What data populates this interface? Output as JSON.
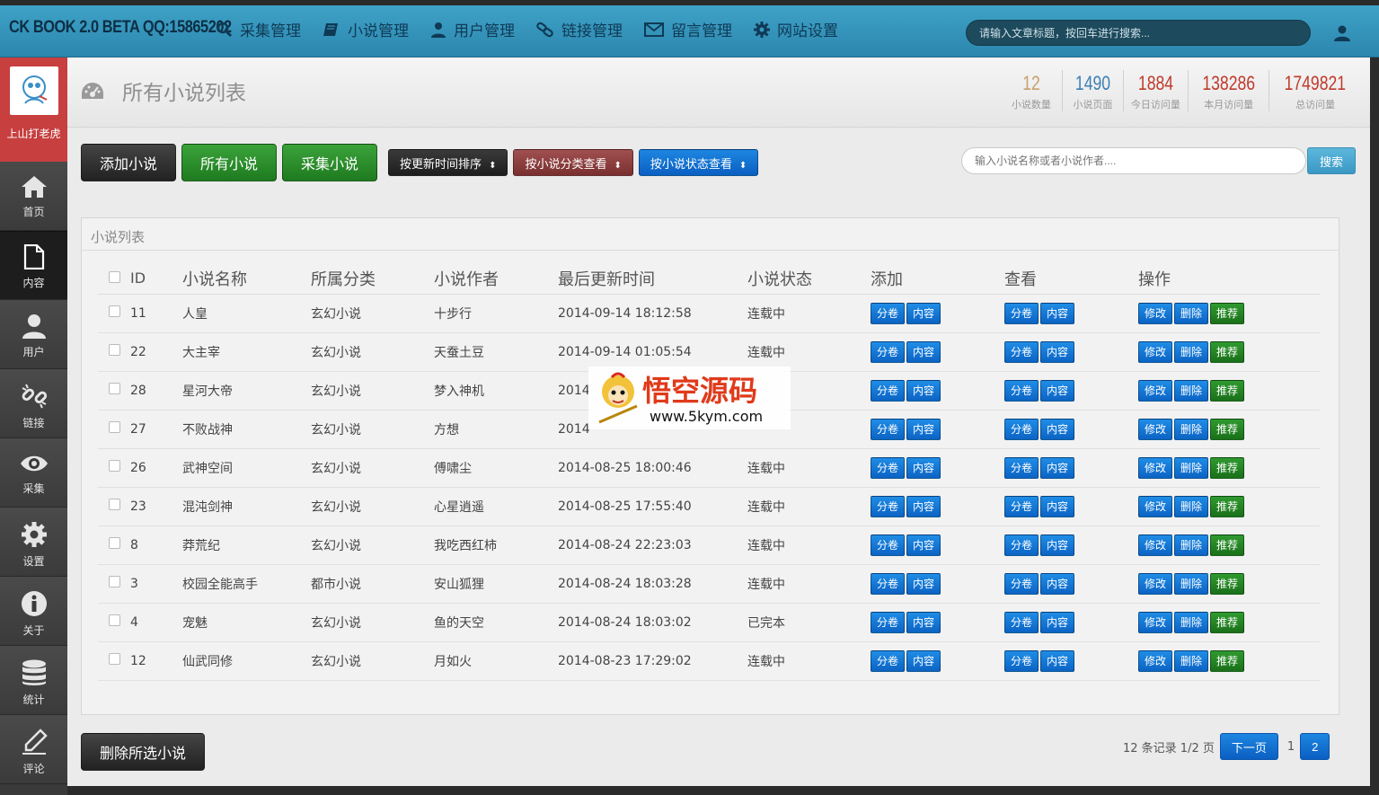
{
  "brand": "CK BOOK 2.0 BETA QQ:15865202",
  "nav": [
    {
      "label": "采集管理",
      "icon": "search-icon"
    },
    {
      "label": "小说管理",
      "icon": "book-icon"
    },
    {
      "label": "用户管理",
      "icon": "user-icon"
    },
    {
      "label": "链接管理",
      "icon": "link-icon"
    },
    {
      "label": "留言管理",
      "icon": "mail-icon"
    },
    {
      "label": "网站设置",
      "icon": "gear-icon"
    }
  ],
  "top_search": {
    "placeholder": "请输入文章标题，按回车进行搜索..."
  },
  "sidebar": {
    "profile_name": "上山打老虎",
    "items": [
      {
        "label": "首页",
        "icon": "home-icon"
      },
      {
        "label": "内容",
        "icon": "document-icon",
        "active": true
      },
      {
        "label": "用户",
        "icon": "user-icon"
      },
      {
        "label": "链接",
        "icon": "broken-link-icon"
      },
      {
        "label": "采集",
        "icon": "eye-icon"
      },
      {
        "label": "设置",
        "icon": "gear-icon"
      },
      {
        "label": "关于",
        "icon": "info-icon"
      },
      {
        "label": "统计",
        "icon": "database-icon"
      },
      {
        "label": "评论",
        "icon": "pencil-icon"
      }
    ]
  },
  "page": {
    "title": "所有小说列表"
  },
  "stats": [
    {
      "value": "12",
      "label": "小说数量",
      "color": "#c8a06a"
    },
    {
      "value": "1490",
      "label": "小说页面",
      "color": "#3b7fb5"
    },
    {
      "value": "1884",
      "label": "今日访问量",
      "color": "#c0392b"
    },
    {
      "value": "138286",
      "label": "本月访问量",
      "color": "#c0392b"
    },
    {
      "value": "1749821",
      "label": "总访问量",
      "color": "#c0392b"
    }
  ],
  "toolbar": {
    "add": "添加小说",
    "all": "所有小说",
    "collect": "采集小说",
    "sort_time": "按更新时间排序",
    "by_category": "按小说分类查看",
    "by_status": "按小说状态查看",
    "search_placeholder": "输入小说名称或者小说作者....",
    "search_button": "搜索"
  },
  "panel": {
    "title": "小说列表"
  },
  "table": {
    "headers": [
      "ID",
      "小说名称",
      "所属分类",
      "小说作者",
      "最后更新时间",
      "小说状态",
      "添加",
      "查看",
      "操作"
    ],
    "rows": [
      {
        "id": "11",
        "name": "人皇",
        "category": "玄幻小说",
        "author": "十步行",
        "updated": "2014-09-14 18:12:58",
        "status": "连载中"
      },
      {
        "id": "22",
        "name": "大主宰",
        "category": "玄幻小说",
        "author": "天蚕土豆",
        "updated": "2014-09-14 01:05:54",
        "status": "连载中"
      },
      {
        "id": "28",
        "name": "星河大帝",
        "category": "玄幻小说",
        "author": "梦入神机",
        "updated": "2014",
        "status": ""
      },
      {
        "id": "27",
        "name": "不败战神",
        "category": "玄幻小说",
        "author": "方想",
        "updated": "2014",
        "status": ""
      },
      {
        "id": "26",
        "name": "武神空间",
        "category": "玄幻小说",
        "author": "傅啸尘",
        "updated": "2014-08-25 18:00:46",
        "status": "连载中"
      },
      {
        "id": "23",
        "name": "混沌剑神",
        "category": "玄幻小说",
        "author": "心星逍遥",
        "updated": "2014-08-25 17:55:40",
        "status": "连载中"
      },
      {
        "id": "8",
        "name": "莽荒纪",
        "category": "玄幻小说",
        "author": "我吃西红柿",
        "updated": "2014-08-24 22:23:03",
        "status": "连载中"
      },
      {
        "id": "3",
        "name": "校园全能高手",
        "category": "都市小说",
        "author": "安山狐狸",
        "updated": "2014-08-24 18:03:28",
        "status": "连载中"
      },
      {
        "id": "4",
        "name": "宠魅",
        "category": "玄幻小说",
        "author": "鱼的天空",
        "updated": "2014-08-24 18:03:02",
        "status": "已完本"
      },
      {
        "id": "12",
        "name": "仙武同修",
        "category": "玄幻小说",
        "author": "月如火",
        "updated": "2014-08-23 17:29:02",
        "status": "连载中"
      }
    ],
    "btn_volume": "分卷",
    "btn_content": "内容",
    "btn_edit": "修改",
    "btn_delete": "删除",
    "btn_recommend": "推荐"
  },
  "footer": {
    "delete_selected": "删除所选小说",
    "records": "12 条记录 1/2 页",
    "next": "下一页",
    "page1": "1",
    "page2": "2"
  },
  "watermark": {
    "title": "悟空源码",
    "url": "www.5kym.com"
  }
}
